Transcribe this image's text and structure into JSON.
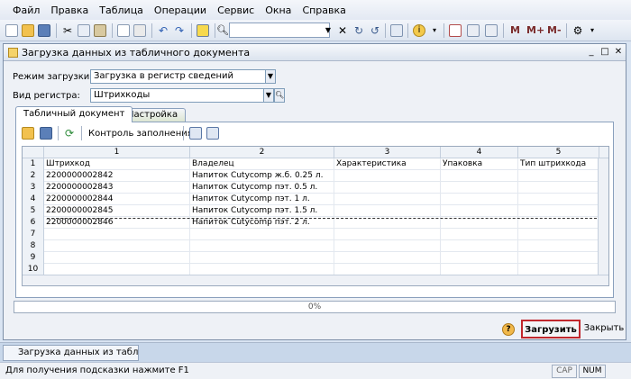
{
  "menu": [
    "Файл",
    "Правка",
    "Таблица",
    "Операции",
    "Сервис",
    "Окна",
    "Справка"
  ],
  "toolbar_right": [
    "M",
    "M+",
    "M-"
  ],
  "window": {
    "title": "Загрузка данных из табличного документа",
    "mode_label": "Режим загрузки:",
    "mode_value": "Загрузка в регистр сведений",
    "register_label": "Вид регистра:",
    "register_value": "Штрихкоды"
  },
  "tabs": [
    "Табличный документ",
    "Настройка"
  ],
  "inner_toolbar": {
    "fill_control": "Контроль заполнения"
  },
  "grid": {
    "column_numbers": [
      "1",
      "2",
      "3",
      "4",
      "5"
    ],
    "rows": [
      [
        "1",
        "Штрихкод",
        "Владелец",
        "Характеристика",
        "Упаковка",
        "Тип штрихкода"
      ],
      [
        "2",
        "2200000002842",
        "Напиток Cutycomp ж.б. 0.25 л.",
        "",
        "",
        ""
      ],
      [
        "3",
        "2200000002843",
        "Напиток Cutycomp пэт. 0.5 л.",
        "",
        "",
        ""
      ],
      [
        "4",
        "2200000002844",
        "Напиток Cutycomp пэт. 1 л.",
        "",
        "",
        ""
      ],
      [
        "5",
        "2200000002845",
        "Напиток Cutycomp пэт. 1.5 л.",
        "",
        "",
        ""
      ],
      [
        "6",
        "2200000002846",
        "Напиток Cutycomp пэт. 2 л.",
        "",
        "",
        ""
      ],
      [
        "7",
        "",
        "",
        "",
        "",
        ""
      ],
      [
        "8",
        "",
        "",
        "",
        "",
        ""
      ],
      [
        "9",
        "",
        "",
        "",
        "",
        ""
      ],
      [
        "10",
        "",
        "",
        "",
        "",
        ""
      ]
    ]
  },
  "progress": "0%",
  "buttons": {
    "load": "Загрузить",
    "close": "Закрыть",
    "help": "?"
  },
  "taskbar": {
    "tab": "Загрузка данных из таблич..."
  },
  "status": {
    "hint": "Для получения подсказки нажмите F1",
    "cap": "CAP",
    "num": "NUM"
  },
  "colors": {
    "accent_border": "#c1272d",
    "window_bg": "#eef1f6"
  }
}
